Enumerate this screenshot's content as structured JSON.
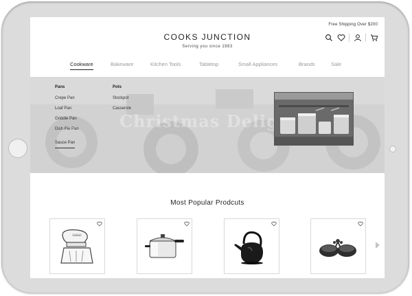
{
  "header": {
    "promo_text": "Free Shipping Over $200",
    "brand": "COOKS JUNCTION",
    "tagline": "Serving you since 1983",
    "icons": [
      "search-icon",
      "heart-icon",
      "user-icon",
      "cart-icon"
    ]
  },
  "nav": {
    "items": [
      {
        "label": "Cookware",
        "active": true
      },
      {
        "label": "Bakeware",
        "active": false
      },
      {
        "label": "Kitchen Tools",
        "active": false
      },
      {
        "label": "Tabletop",
        "active": false
      },
      {
        "label": "Small Appliances",
        "active": false
      },
      {
        "label": "Brands",
        "active": false
      },
      {
        "label": "Sale",
        "active": false
      }
    ]
  },
  "mega_menu": {
    "columns": [
      {
        "title": "Pans",
        "items": [
          "Crepe Pan",
          "Loaf Pan",
          "Griddle Pan",
          "Dish Pie Pan",
          "Sauce Pan"
        ],
        "active_item": "Sauce Pan"
      },
      {
        "title": "Pots",
        "items": [
          "Stockpot",
          "Casserole"
        ]
      }
    ],
    "background_text": "Christmas Delights"
  },
  "products": {
    "title": "Most Popular Prodcuts",
    "items": [
      {
        "name": "hand-mixer-icon",
        "brand_mark": "Cuisinart"
      },
      {
        "name": "pressure-cooker-icon"
      },
      {
        "name": "teapot-icon"
      },
      {
        "name": "serving-bowls-icon"
      }
    ]
  },
  "colors": {
    "frame": "#dcdcdc",
    "hero": "#d7d7d7",
    "text": "#222222",
    "muted": "#999999"
  }
}
